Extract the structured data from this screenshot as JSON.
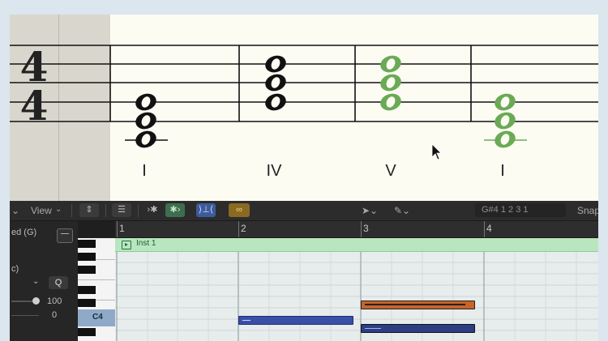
{
  "score": {
    "time_signature": {
      "top": "4",
      "bottom": "4"
    },
    "numerals": [
      "I",
      "IV",
      "V",
      "I"
    ],
    "chord_colors": {
      "default": "#111111",
      "highlighted": "#6aaa55"
    }
  },
  "toolbar": {
    "view_menu": "View",
    "position_display": "G#4  1 2 3 1",
    "snap_label": "Snap"
  },
  "inspector": {
    "region_key": "ed (G)",
    "section_label": "c)",
    "q_button": "Q",
    "velocity_value": "100",
    "offset_value": "0"
  },
  "piano": {
    "c4_label": "C4"
  },
  "ruler": {
    "bars": [
      "1",
      "2",
      "3",
      "4"
    ]
  },
  "region": {
    "name": "Inst 1",
    "header_color": "#b8e7bf",
    "body_color": "#e7ecec"
  },
  "notes": {
    "blue": "#3a4fa8",
    "selected": "#c86428"
  }
}
